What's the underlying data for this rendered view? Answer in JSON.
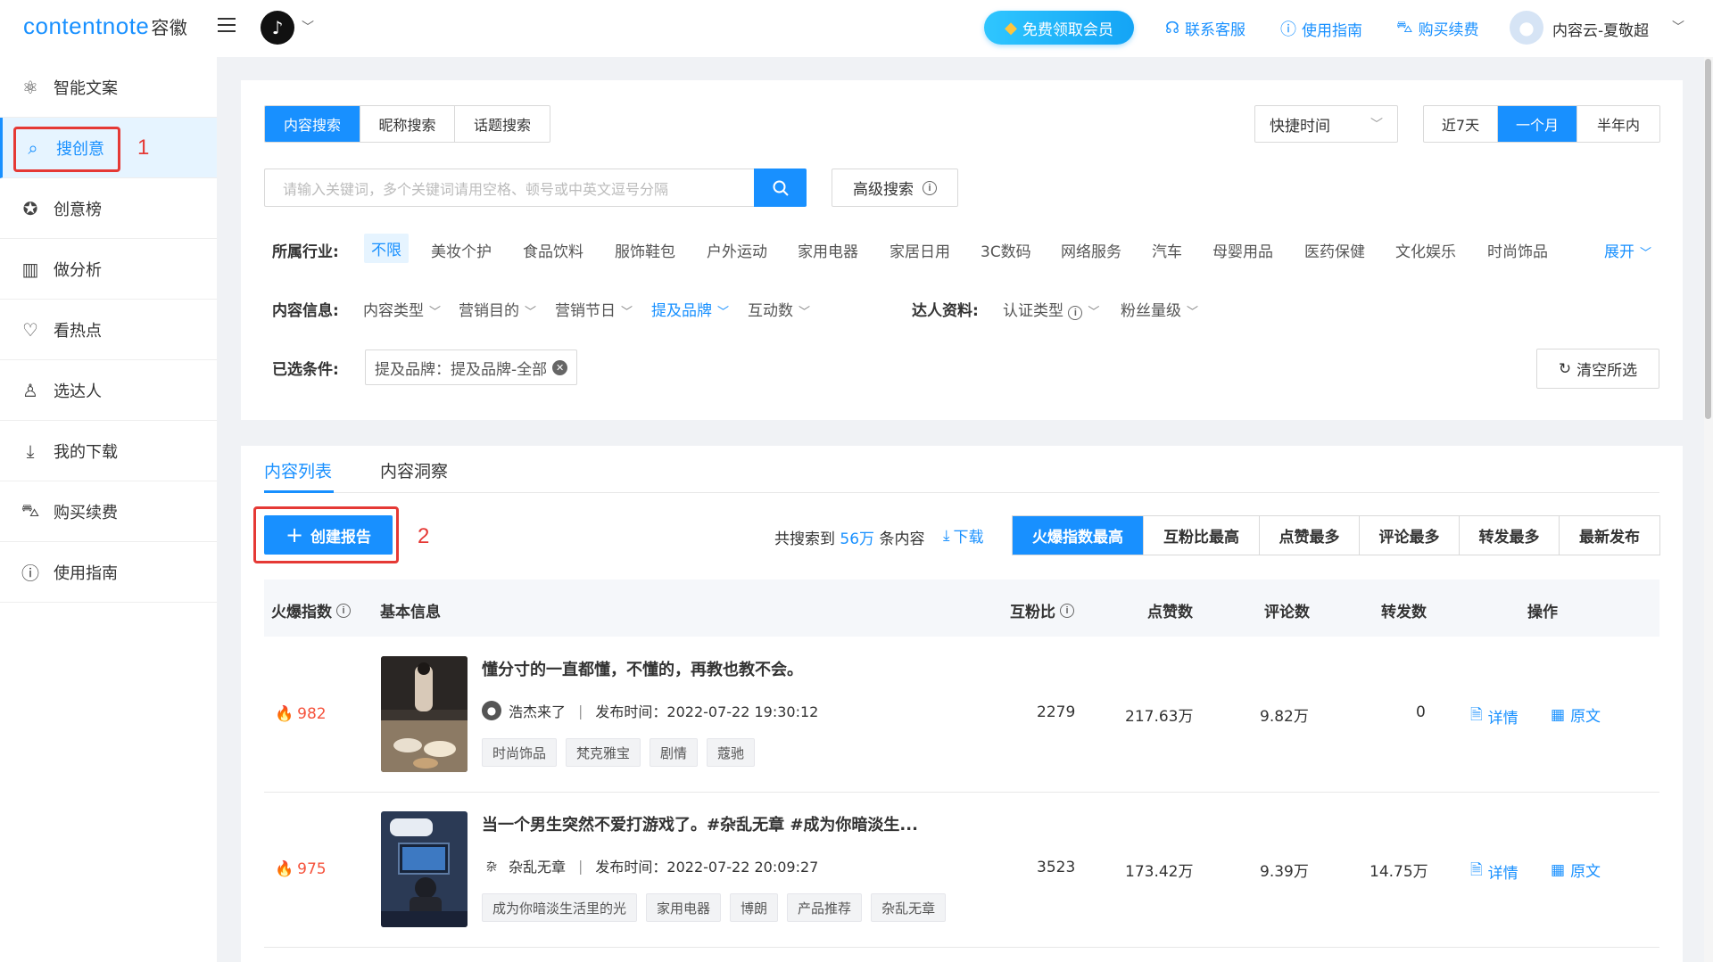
{
  "header": {
    "logo_en": "contentnote",
    "logo_cn": "容徽",
    "vip_label": "免费领取会员",
    "links": [
      {
        "label": "联系客服",
        "icon": "headset-icon"
      },
      {
        "label": "使用指南",
        "icon": "question-icon"
      },
      {
        "label": "购买续费",
        "icon": "cart-icon"
      }
    ],
    "user_name": "内容云-夏敬超"
  },
  "sidebar": {
    "items": [
      {
        "label": "智能文案",
        "icon": "ai-icon"
      },
      {
        "label": "搜创意",
        "icon": "search-idea-icon"
      },
      {
        "label": "创意榜",
        "icon": "award-icon"
      },
      {
        "label": "做分析",
        "icon": "bar-chart-icon"
      },
      {
        "label": "看热点",
        "icon": "heartbeat-icon"
      },
      {
        "label": "选达人",
        "icon": "person-icon"
      },
      {
        "label": "我的下载",
        "icon": "download-icon"
      },
      {
        "label": "购买续费",
        "icon": "cart-icon"
      },
      {
        "label": "使用指南",
        "icon": "question-icon"
      }
    ],
    "active_index": 1
  },
  "annotations": {
    "n1": "1",
    "n2": "2"
  },
  "search": {
    "tabs": [
      "内容搜索",
      "昵称搜索",
      "话题搜索"
    ],
    "active_tab": 0,
    "placeholder": "请输入关键词，多个关键词请用空格、顿号或中英文逗号分隔",
    "advanced_label": "高级搜索",
    "quick_time": "快捷时间",
    "time_ranges": [
      "近7天",
      "一个月",
      "半年内"
    ],
    "active_time": 1
  },
  "filters": {
    "industry_label": "所属行业:",
    "industries": [
      "不限",
      "美妆个护",
      "食品饮料",
      "服饰鞋包",
      "户外运动",
      "家用电器",
      "家居日用",
      "3C数码",
      "网络服务",
      "汽车",
      "母婴用品",
      "医药保健",
      "文化娱乐",
      "时尚饰品"
    ],
    "expand_label": "展开",
    "content_label": "内容信息:",
    "content_filters": [
      "内容类型",
      "营销目的",
      "营销节日",
      "提及品牌",
      "互动数"
    ],
    "talent_label": "达人资料:",
    "talent_filters": [
      "认证类型",
      "粉丝量级"
    ],
    "selected_label": "已选条件:",
    "selected_tag": "提及品牌：提及品牌-全部",
    "clear_label": "清空所选"
  },
  "list": {
    "tabs": [
      "内容列表",
      "内容洞察"
    ],
    "create_label": "创建报告",
    "total_prefix": "共搜索到",
    "total_num": "56万",
    "total_suffix": "条内容",
    "download_label": "下载",
    "sorts": [
      "火爆指数最高",
      "互粉比最高",
      "点赞最多",
      "评论最多",
      "转发最多",
      "最新发布"
    ],
    "columns": {
      "heat": "火爆指数",
      "info": "基本信息",
      "ratio": "互粉比",
      "likes": "点赞数",
      "comments": "评论数",
      "shares": "转发数",
      "ops": "操作"
    },
    "detail_label": "详情",
    "origin_label": "原文",
    "rows": [
      {
        "heat": "982",
        "title": "懂分寸的一直都懂，不懂的，再教也教不会。",
        "author": "浩杰来了",
        "publish": "发布时间：2022-07-22 19:30:12",
        "tags": [
          "时尚饰品",
          "梵克雅宝",
          "剧情",
          "蔻驰"
        ],
        "ratio": "2279",
        "likes": "217.63万",
        "comments": "9.82万",
        "shares": "0"
      },
      {
        "heat": "975",
        "title": "当一个男生突然不爱打游戏了。#杂乱无章 #成为你暗淡生...",
        "author": "杂乱无章",
        "author_glyph": "杂",
        "publish": "发布时间：2022-07-22 20:09:27",
        "tags": [
          "成为你暗淡生活里的光",
          "家用电器",
          "博朗",
          "产品推荐",
          "杂乱无章"
        ],
        "ratio": "3523",
        "likes": "173.42万",
        "comments": "9.39万",
        "shares": "14.75万"
      }
    ]
  }
}
